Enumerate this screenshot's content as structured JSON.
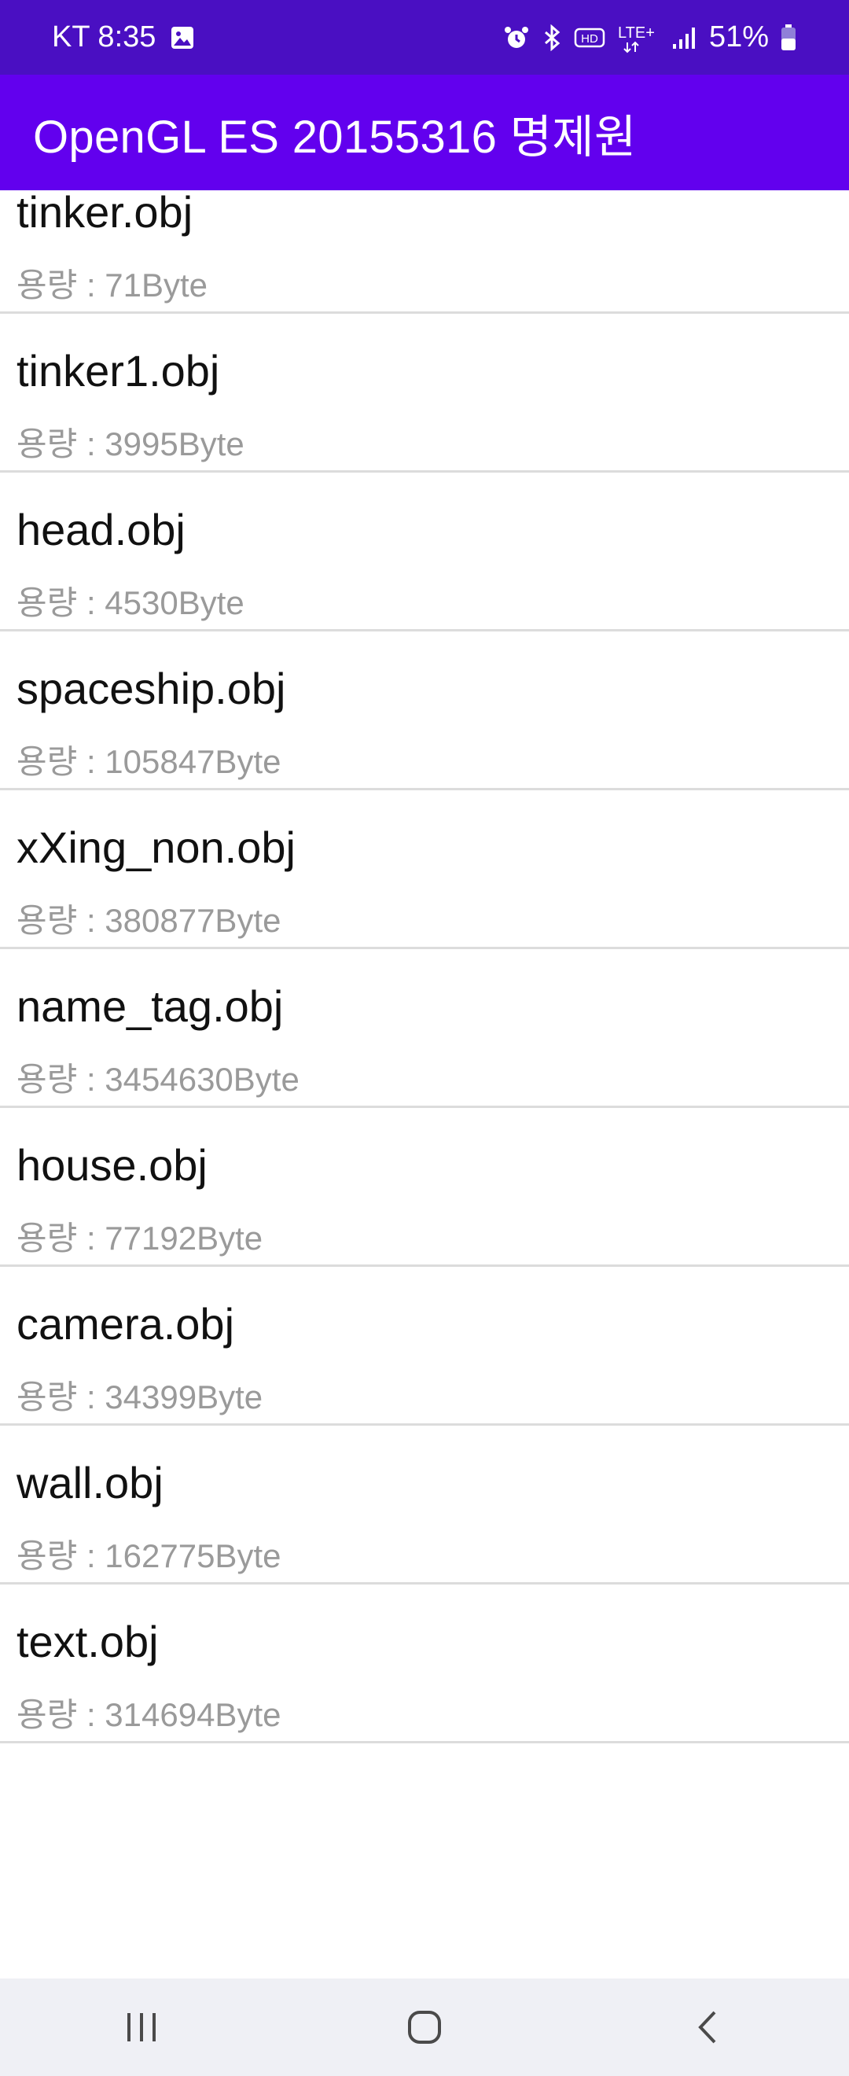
{
  "status_bar": {
    "carrier_time": "KT 8:35",
    "hd_label": "HD",
    "lte_label": "LTE+",
    "battery_percent": "51%",
    "battery_level": 0.51
  },
  "app_bar": {
    "title": "OpenGL ES 20155316 명제원"
  },
  "files": [
    {
      "name": "tinker.obj",
      "size": "용량 : 71Byte"
    },
    {
      "name": "tinker1.obj",
      "size": "용량 : 3995Byte"
    },
    {
      "name": "head.obj",
      "size": "용량 : 4530Byte"
    },
    {
      "name": "spaceship.obj",
      "size": "용량 : 105847Byte"
    },
    {
      "name": "xXing_non.obj",
      "size": "용량 : 380877Byte"
    },
    {
      "name": "name_tag.obj",
      "size": "용량 : 3454630Byte"
    },
    {
      "name": "house.obj",
      "size": "용량 : 77192Byte"
    },
    {
      "name": "camera.obj",
      "size": "용량 : 34399Byte"
    },
    {
      "name": "wall.obj",
      "size": "용량 : 162775Byte"
    },
    {
      "name": "text.obj",
      "size": "용량 : 314694Byte"
    }
  ],
  "nav_bar": {
    "buttons": [
      "recent-apps-icon",
      "home-icon",
      "back-icon"
    ]
  }
}
